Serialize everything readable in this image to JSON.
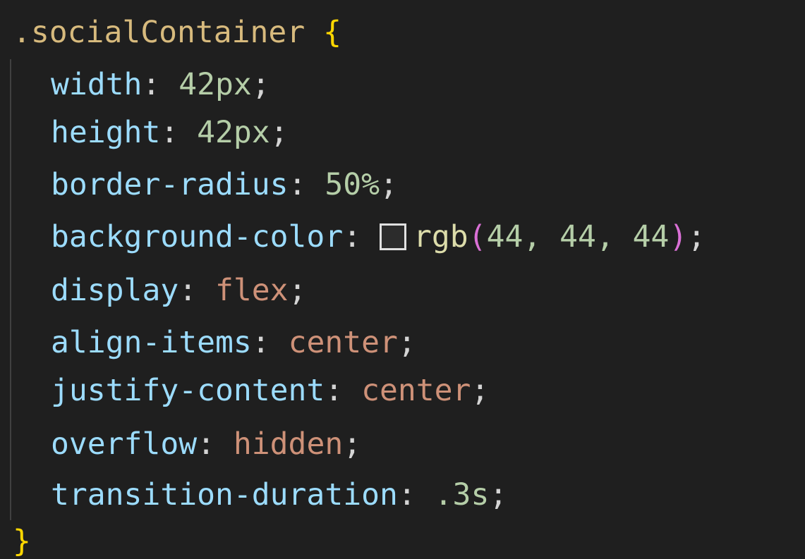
{
  "code": {
    "selector": ".socialContainer",
    "open_brace": "{",
    "close_brace": "}",
    "colors": {
      "background": "#1f1f1f",
      "property": "#9cdcfe",
      "number": "#b5cea8",
      "keyword_value": "#ce9178",
      "brace": "#ffd700",
      "function": "#dcdcaa",
      "paren": "#da70d6",
      "swatch": "#2c2c2c"
    },
    "lines": [
      {
        "property": "width",
        "value": "42px"
      },
      {
        "property": "height",
        "value": "42px"
      },
      {
        "property": "border-radius",
        "value": "50%"
      },
      {
        "property": "background-color",
        "func": "rgb",
        "args": "44, 44, 44"
      },
      {
        "property": "display",
        "value": "flex"
      },
      {
        "property": "align-items",
        "value": "center"
      },
      {
        "property": "justify-content",
        "value": "center"
      },
      {
        "property": "overflow",
        "value": "hidden"
      },
      {
        "property": "transition-duration",
        "value": ".3s"
      }
    ]
  }
}
